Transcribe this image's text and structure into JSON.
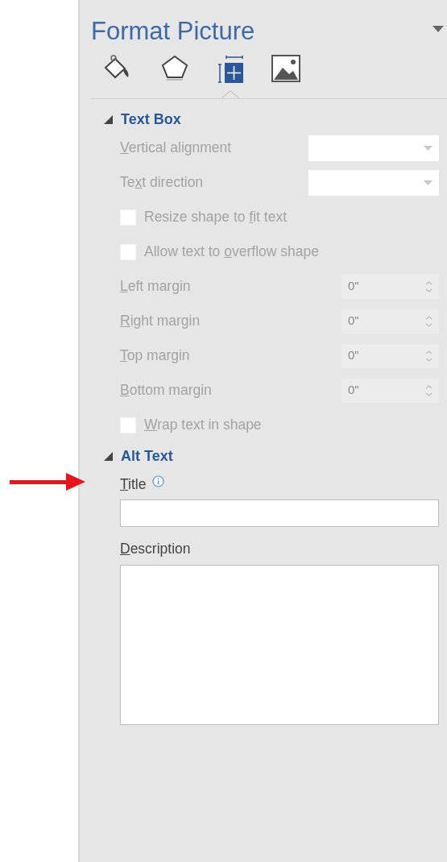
{
  "panel": {
    "title": "Format Picture"
  },
  "tabs": [
    {
      "kind": "fill",
      "selected": false
    },
    {
      "kind": "effects",
      "selected": false
    },
    {
      "kind": "layout",
      "selected": true
    },
    {
      "kind": "picture",
      "selected": false
    }
  ],
  "sections": [
    {
      "title": "Text Box",
      "expanded": true,
      "disabled": true,
      "rows": [
        {
          "kind": "dropdown",
          "label": {
            "key": "V",
            "after": "ertical alignment"
          }
        },
        {
          "kind": "dropdown",
          "label": {
            "before": "Te",
            "key": "x",
            "after": "t direction"
          }
        },
        {
          "kind": "checkbox",
          "checked": false,
          "label": {
            "before": "Resize shape to ",
            "key": "f",
            "after": "it text"
          }
        },
        {
          "kind": "checkbox",
          "checked": false,
          "label": {
            "before": "Allow text to ",
            "key": "o",
            "after": "verflow shape"
          }
        },
        {
          "kind": "spinner",
          "value": "0\"",
          "label": {
            "key": "L",
            "after": "eft margin"
          }
        },
        {
          "kind": "spinner",
          "value": "0\"",
          "label": {
            "key": "R",
            "after": "ight margin"
          }
        },
        {
          "kind": "spinner",
          "value": "0\"",
          "label": {
            "key": "T",
            "after": "op margin"
          }
        },
        {
          "kind": "spinner",
          "value": "0\"",
          "label": {
            "key": "B",
            "after": "ottom margin"
          }
        },
        {
          "kind": "checkbox",
          "checked": false,
          "label": {
            "key": "W",
            "after": "rap text in shape"
          }
        }
      ]
    },
    {
      "title": "Alt Text",
      "expanded": true,
      "disabled": false,
      "rows": [
        {
          "kind": "textfield",
          "info": true,
          "label": {
            "key": "T",
            "after": "itle"
          }
        },
        {
          "kind": "textarea",
          "info": false,
          "label": {
            "key": "D",
            "after": "escription"
          }
        }
      ]
    }
  ]
}
